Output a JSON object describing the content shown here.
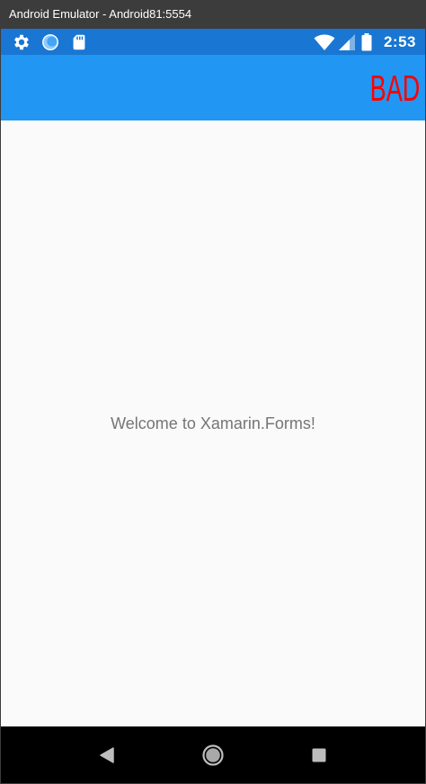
{
  "window": {
    "title": "Android Emulator - Android81:5554"
  },
  "status_bar": {
    "left_icons": [
      "gear-icon",
      "sync-circle-icon",
      "sd-card-icon"
    ],
    "right_icons": [
      "wifi-icon",
      "cell-signal-icon",
      "battery-icon"
    ],
    "time": "2:53",
    "color": "#1976d2"
  },
  "app_bar": {
    "color": "#2196f3",
    "toolbar_item": {
      "label": "BAD",
      "color": "#ff0000"
    }
  },
  "content": {
    "welcome_text": "Welcome to Xamarin.Forms!"
  },
  "nav_bar": {
    "buttons": [
      "back-icon",
      "home-icon",
      "recents-icon"
    ]
  }
}
